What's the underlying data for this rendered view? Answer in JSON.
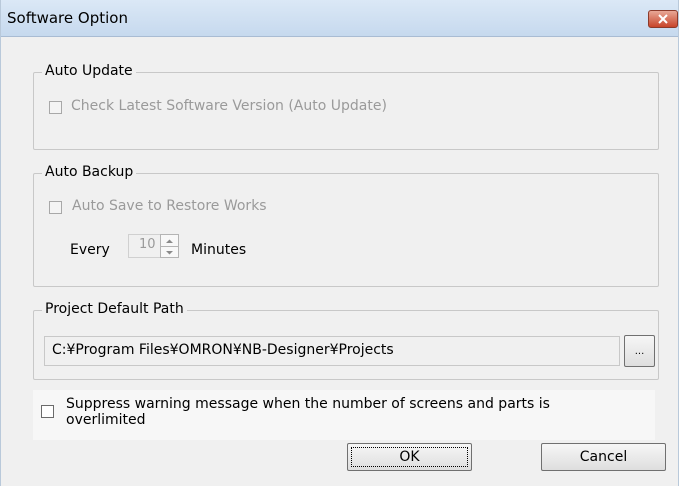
{
  "window": {
    "title": "Software Option"
  },
  "auto_update": {
    "legend": "Auto Update",
    "check_label": "Check Latest Software Version (Auto Update)",
    "checked": false
  },
  "auto_backup": {
    "legend": "Auto Backup",
    "save_label": "Auto Save to Restore Works",
    "checked": false,
    "every_label": "Every",
    "interval_value": "10",
    "minutes_label": "Minutes"
  },
  "project_path": {
    "legend": "Project Default Path",
    "path_value": "C:¥Program Files¥OMRON¥NB-Designer¥Projects",
    "browse_label": "..."
  },
  "suppress_warning": {
    "label_line1": "Suppress warning message when the number of screens and parts is",
    "label_line2": "overlimited",
    "checked": false
  },
  "buttons": {
    "ok_label": "OK",
    "cancel_label": "Cancel"
  }
}
